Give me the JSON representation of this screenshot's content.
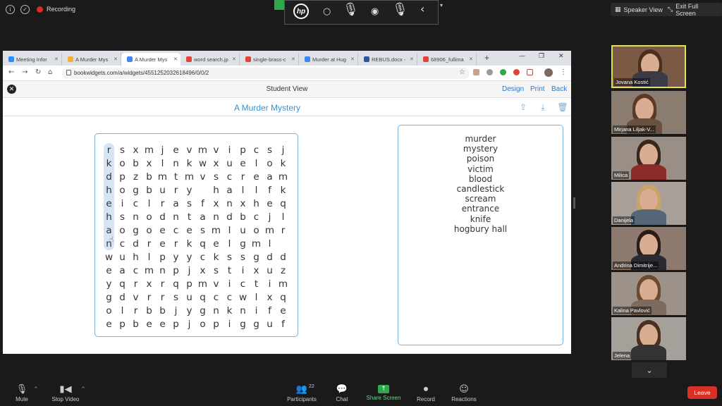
{
  "zoom_top": {
    "recording_label": "Recording",
    "hp_logo": "hp",
    "speaker_view_label": "Speaker View",
    "exit_full_screen_label": "Exit Full Screen"
  },
  "browser": {
    "tabs": [
      {
        "label": "Meeting Infor",
        "color": "#2d8cff"
      },
      {
        "label": "A Murder Mys",
        "color": "#f2b134"
      },
      {
        "label": "A Murder Mys",
        "color": "#4285f4"
      },
      {
        "label": "word search.jp",
        "color": "#e0443a"
      },
      {
        "label": "single-brass-c",
        "color": "#e0443a"
      },
      {
        "label": "Murder at Hug",
        "color": "#4285f4"
      },
      {
        "label": "REBUS.docx -",
        "color": "#2b579a"
      },
      {
        "label": "68906_fullima",
        "color": "#e0443a"
      }
    ],
    "new_tab": "+",
    "url": "bookwidgets.com/a/widgets/4551252032618496/0/0/2"
  },
  "page": {
    "student_view": "Student View",
    "design_link": "Design",
    "print_link": "Print",
    "back_link": "Back",
    "title": "A Murder Mystery",
    "grid": [
      "rsxmjevmvipcsj",
      "kobxlnkwxuelok",
      "dpzbmtmvscream",
      "hogbury hallfk",
      "eiclrasfxnxheq",
      "hsnodntandbcjl",
      "aogoecesmluomr",
      "ncdrerkqelgml ",
      "wuhlpyyckssgdd",
      "eacmnpjxstixuz",
      "yqrxrqpmvictim",
      "gdvrrsuqccwlxq",
      "olrbbjygnknife",
      "epbeepjopiggu f"
    ],
    "words": [
      "murder",
      "mystery",
      "poison",
      "victim",
      "blood",
      "candlestick",
      "scream",
      "entrance",
      "knife",
      "hogbury hall"
    ]
  },
  "participants": [
    {
      "name": "Jovana Kostić",
      "speaking": true
    },
    {
      "name": "Mirjana Liljak-V...",
      "speaking": false
    },
    {
      "name": "Milica",
      "speaking": false
    },
    {
      "name": "Danijela",
      "speaking": false
    },
    {
      "name": "Andrina Dimitrije...",
      "speaking": false
    },
    {
      "name": "Kalina Pavlović",
      "speaking": false
    },
    {
      "name": "Jelena",
      "speaking": false
    }
  ],
  "toolbar": {
    "mute": "Mute",
    "stop_video": "Stop Video",
    "participants": "Participants",
    "participants_count": "22",
    "chat": "Chat",
    "share_screen": "Share Screen",
    "record": "Record",
    "reactions": "Reactions",
    "leave": "Leave"
  }
}
